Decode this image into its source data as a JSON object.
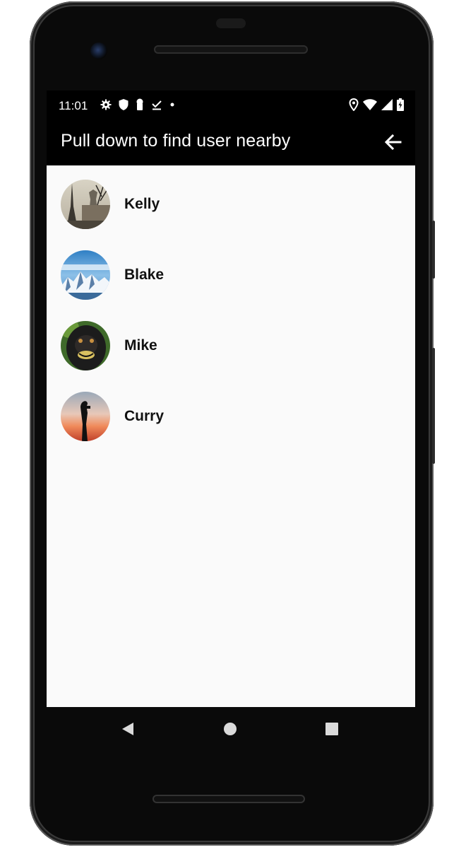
{
  "status_bar": {
    "time": "11:01",
    "left_icons": [
      "gear-icon",
      "shield-icon",
      "keyhole-icon",
      "download-done-icon",
      "dot-icon"
    ],
    "right_icons": [
      "location-icon",
      "wifi-icon",
      "signal-icon",
      "battery-charging-icon"
    ]
  },
  "app_bar": {
    "title": "Pull down to find user nearby",
    "back_icon": "arrow-left-icon"
  },
  "users": [
    {
      "name": "Kelly",
      "avatar": "eiffel-tower-photo"
    },
    {
      "name": "Blake",
      "avatar": "snowy-mountains-photo"
    },
    {
      "name": "Mike",
      "avatar": "monkey-photo"
    },
    {
      "name": "Curry",
      "avatar": "photographer-silhouette-photo"
    }
  ],
  "nav_bar": {
    "back": "triangle-back-icon",
    "home": "circle-home-icon",
    "recents": "square-recents-icon"
  },
  "colors": {
    "app_bar_bg": "#000000",
    "content_bg": "#fafafa",
    "text": "#111111"
  }
}
